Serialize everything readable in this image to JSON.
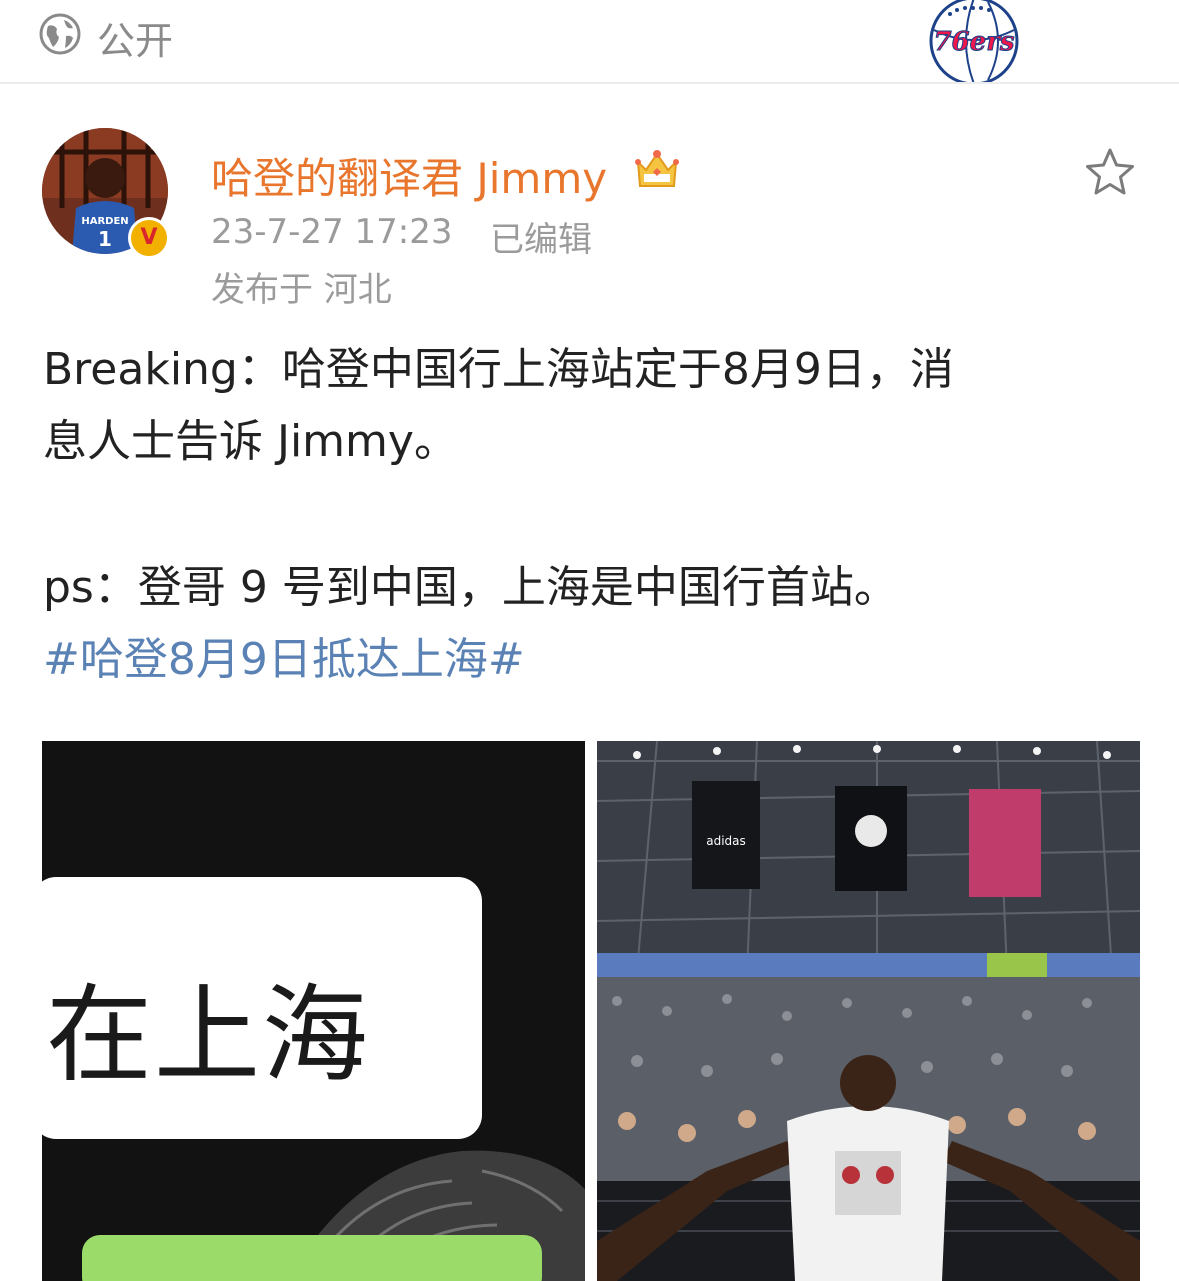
{
  "topbar": {
    "visibility_label": "公开",
    "team_logo_text": "76ers"
  },
  "post": {
    "author": {
      "name": "哈登的翻译君 Jimmy",
      "verified_badge": "V",
      "jersey_text": "HARDEN",
      "jersey_number": "1"
    },
    "timestamp": "23-7-27 17:23",
    "edited_label": "已编辑",
    "location": "发布于 河北",
    "text_lines": [
      "Breaking：哈登中国行上海站定于8月9日，消",
      "息人士告诉 Jimmy。",
      "ps：登哥 9 号到中国，上海是中国行首站。"
    ],
    "hashtag": "#哈登8月9日抵达上海#",
    "images": {
      "first": {
        "bubble_text": "在上海"
      },
      "second": {
        "banner_brand": "adidas"
      }
    }
  },
  "colors": {
    "username": "#e8762d",
    "hashtag": "#5b82b5",
    "meta": "#9b9b9b",
    "text": "#222222"
  },
  "icons": [
    "globe-icon",
    "crown-icon",
    "star-icon",
    "verified-badge-icon"
  ]
}
